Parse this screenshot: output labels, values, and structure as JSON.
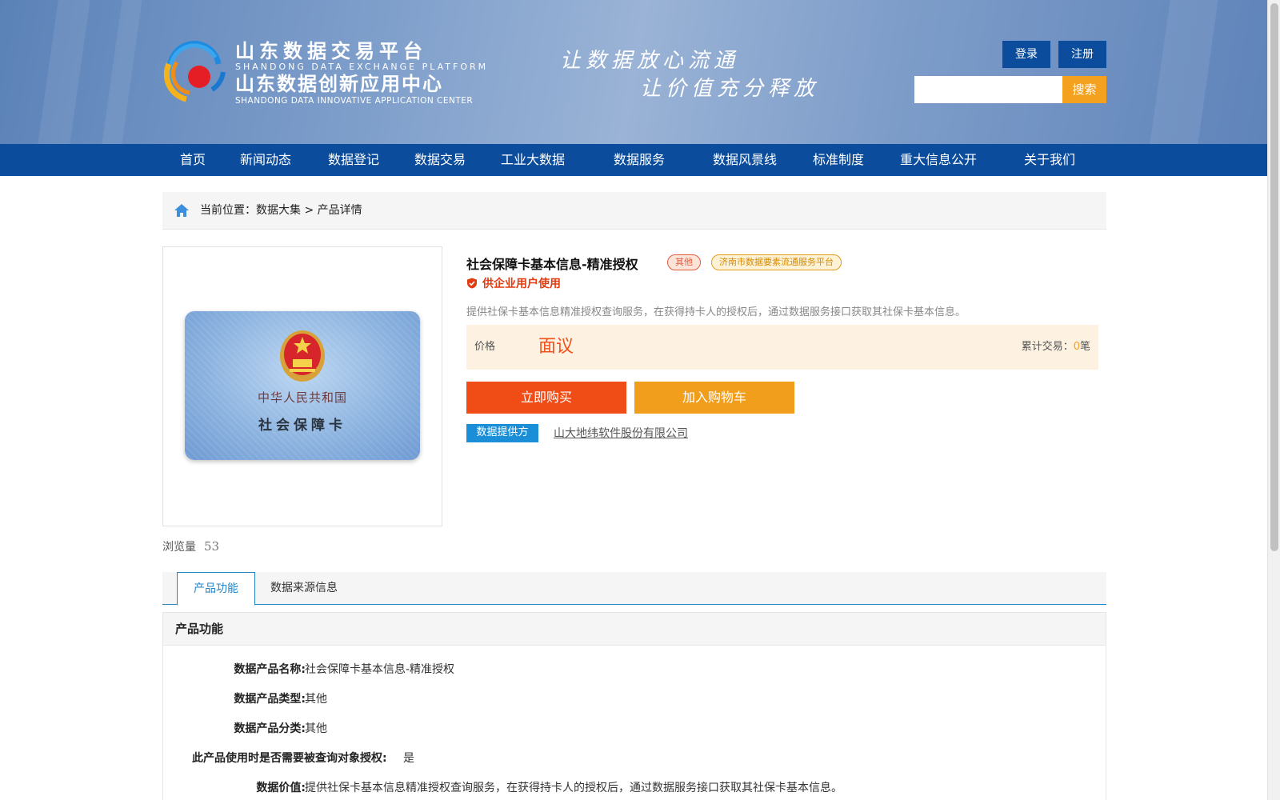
{
  "header": {
    "brand_cn_1": "山东数据交易平台",
    "brand_en_1": "SHANDONG DATA EXCHANGE PLATFORM",
    "brand_cn_2": "山东数据创新应用中心",
    "brand_en_2": "SHANDONG DATA INNOVATIVE APPLICATION CENTER",
    "slogan_1": "让数据放心流通",
    "slogan_2": "让价值充分释放",
    "login_label": "登录",
    "register_label": "注册",
    "search_placeholder": "",
    "search_label": "搜索"
  },
  "nav": {
    "items": [
      {
        "label": "首页"
      },
      {
        "label": "新闻动态"
      },
      {
        "label": "数据登记"
      },
      {
        "label": "数据交易"
      },
      {
        "label": "工业大数据"
      },
      {
        "label": "数据服务"
      },
      {
        "label": "数据风景线"
      },
      {
        "label": "标准制度"
      },
      {
        "label": "重大信息公开"
      },
      {
        "label": "关于我们"
      }
    ]
  },
  "breadcrumb": {
    "text": "当前位置：数据大集 > 产品详情"
  },
  "product": {
    "card_country": "中华人民共和国",
    "card_name": "社会保障卡",
    "views_label": "浏览量",
    "views_count": "53",
    "title": "社会保障卡基本信息-精准授权",
    "tag_other": "其他",
    "tag_platform": "济南市数据要素流通服务平台",
    "enterprise_only": "供企业用户使用",
    "description": "提供社保卡基本信息精准授权查询服务，在获得持卡人的授权后，通过数据服务接口获取其社保卡基本信息。",
    "price_label": "价格",
    "price_value": "面议",
    "trade_label": "累计交易：",
    "trade_count": "0",
    "trade_unit": "笔",
    "buy_label": "立即购买",
    "cart_label": "加入购物车",
    "provider_label": "数据提供方",
    "provider_name": "山大地纬软件股份有限公司"
  },
  "tabs": {
    "active": "产品功能",
    "other": "数据来源信息"
  },
  "function_panel": {
    "title": "产品功能",
    "rows": [
      {
        "key": "数据产品名称:",
        "value": "社会保障卡基本信息-精准授权"
      },
      {
        "key": "数据产品类型:",
        "value": "其他"
      },
      {
        "key": "数据产品分类:",
        "value": "其他"
      },
      {
        "key": "此产品使用时是否需要被查询对象授权:",
        "value": "是"
      },
      {
        "key": "数据价值:",
        "value": "提供社保卡基本信息精准授权查询服务，在获得持卡人的授权后，通过数据服务接口获取其社保卡基本信息。"
      }
    ]
  },
  "colors": {
    "nav_blue": "#0b4d9c",
    "accent_orange": "#f4a11f",
    "buy_red": "#f04d16",
    "tab_blue": "#2386c9"
  }
}
